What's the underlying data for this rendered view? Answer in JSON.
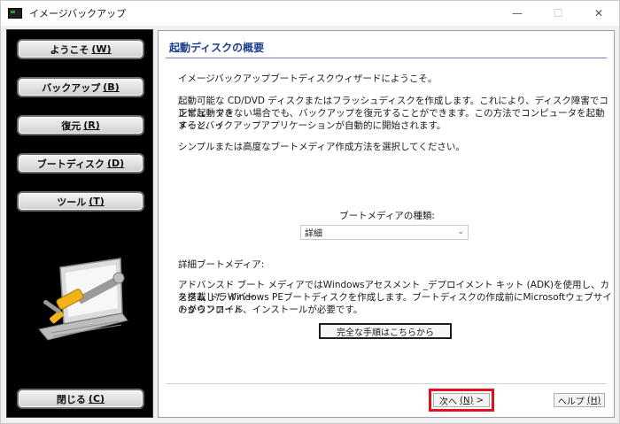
{
  "window": {
    "title": "イメージバックアップ",
    "controls": {
      "minimize": "—",
      "maximize": "☐",
      "close": "✕"
    }
  },
  "sidebar": {
    "items": [
      {
        "label": "ようこそ",
        "accel": "(W)"
      },
      {
        "label": "バックアップ",
        "accel": "(B)"
      },
      {
        "label": "復元",
        "accel": "(R)"
      },
      {
        "label": "ブートディスク",
        "accel": "(D)"
      },
      {
        "label": "ツール",
        "accel": "(T)"
      }
    ],
    "close": {
      "label": "閉じる",
      "accel": "(C)"
    }
  },
  "main": {
    "title": "起動ディスクの概要",
    "intro": "イメージバックアップブートディスクウィザードにようこそ。",
    "desc_line1": "起動可能な CD/DVD ディスクまたはフラッシュディスクを作成します。これにより、ディスク障害でコンピュータを",
    "desc_line2": "正常起動できない場合でも、バックアップを復元することができます。この方法でコンピュータを起動すると、イ",
    "desc_line3": "メージバックアップアプリケーションが自動的に開始されます。",
    "choose": "シンプルまたは高度なブートメディア作成方法を選択してください。",
    "boot_type_label": "ブートメディアの種類:",
    "boot_type_value": "詳細",
    "detail_heading": "詳細ブートメディア:",
    "detail_line1": "アドバンスド ブート メディアではWindowsアセスメント _デプロイメント キット (ADK)を使用し、カスタム ドライバー",
    "detail_line2": "を搭載した Windows PEブートディスクを作成します。ブートディスクの作成前にMicrosoftウェブサイトからファイル",
    "detail_line3": "のダウンロード、インストールが必要です。",
    "steps_button": "完全な手順はこちらから",
    "next": {
      "label": "次へ",
      "accel": "(N)",
      "suffix": ">"
    },
    "help": {
      "label": "ヘルプ",
      "accel": "(H)"
    }
  },
  "colors": {
    "title_blue": "#1b3f8a",
    "highlight_red": "#e3101d",
    "sidebar_bg": "#000000"
  }
}
